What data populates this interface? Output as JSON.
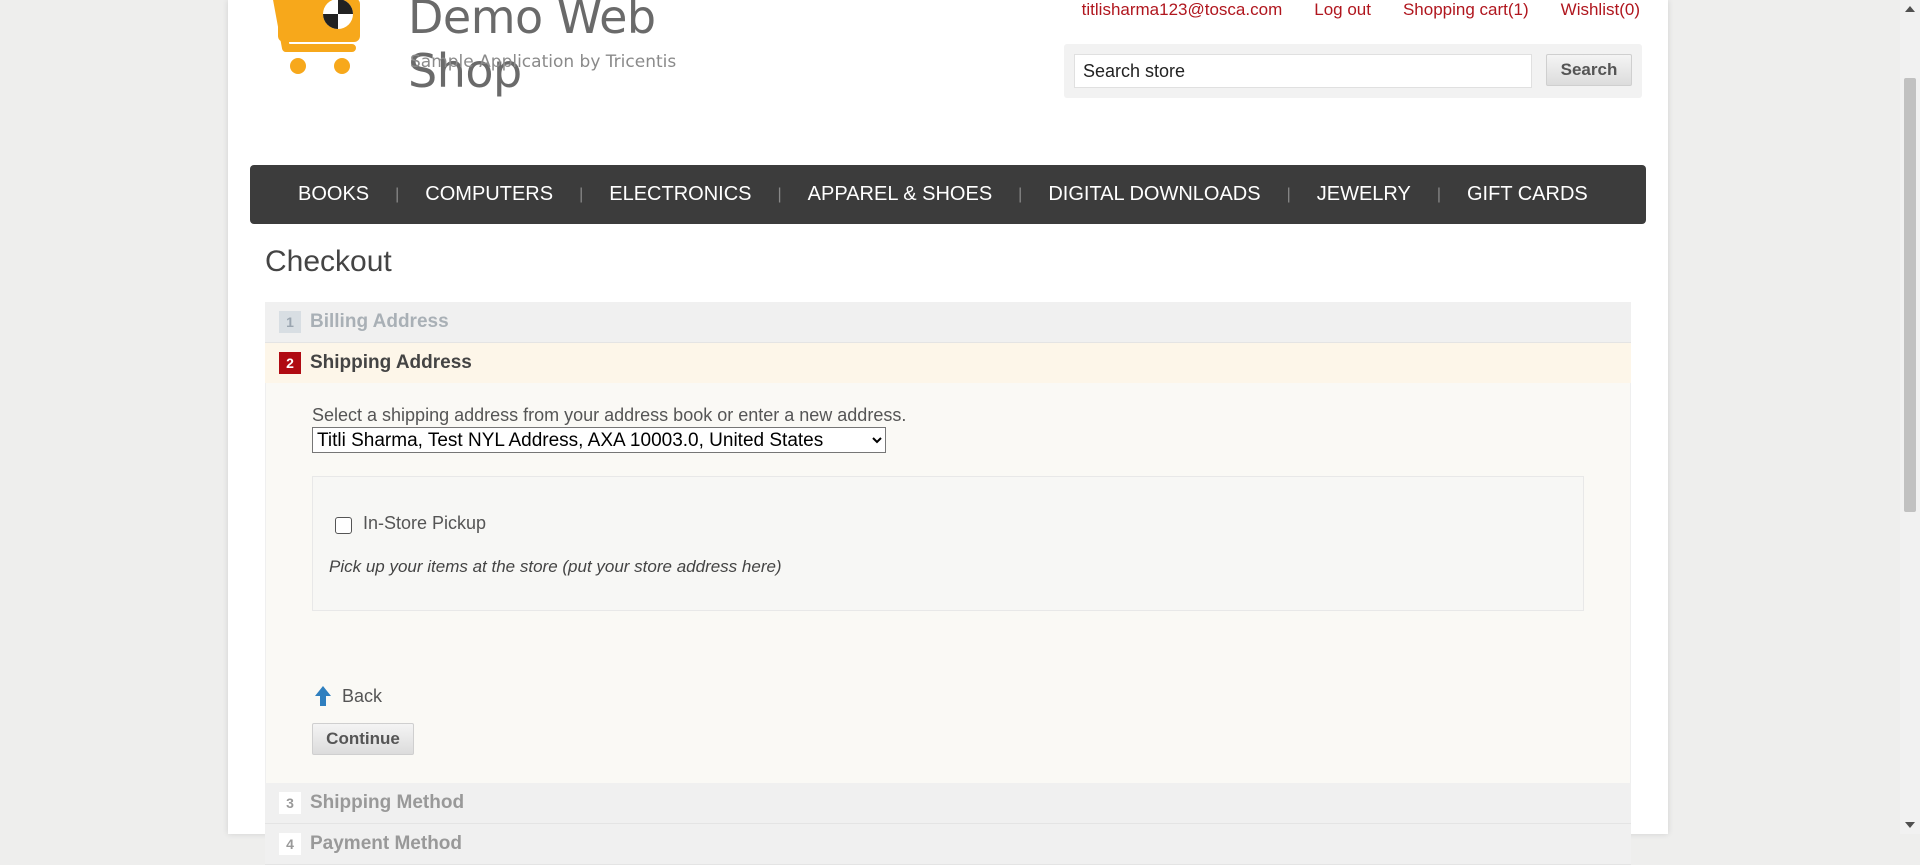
{
  "header": {
    "logo_title": "Demo Web Shop",
    "logo_subtitle": "Sample Application by Tricentis",
    "links": {
      "account": "titlisharma123@tosca.com",
      "logout": "Log out",
      "cart": "Shopping cart(1)",
      "wishlist": "Wishlist(0)"
    },
    "search": {
      "value": "Search store",
      "button": "Search"
    }
  },
  "nav": [
    "BOOKS",
    "COMPUTERS",
    "ELECTRONICS",
    "APPAREL & SHOES",
    "DIGITAL DOWNLOADS",
    "JEWELRY",
    "GIFT CARDS"
  ],
  "checkout": {
    "title": "Checkout",
    "steps": [
      {
        "num": "1",
        "title": "Billing Address",
        "state": "done"
      },
      {
        "num": "2",
        "title": "Shipping Address",
        "state": "active"
      },
      {
        "num": "3",
        "title": "Shipping Method",
        "state": "pending"
      },
      {
        "num": "4",
        "title": "Payment Method",
        "state": "pending"
      }
    ],
    "shipping": {
      "instruction": "Select a shipping address from your address book or enter a new address.",
      "selected_address": "Titli Sharma, Test NYL Address, AXA 10003.0, United States",
      "pickup_label": "In-Store Pickup",
      "pickup_checked": false,
      "pickup_description": "Pick up your items at the store (put your store address here)",
      "back_label": "Back",
      "continue_label": "Continue"
    }
  },
  "colors": {
    "accent": "#b00b12",
    "link": "#b0161e",
    "nav_bg": "#3c3c3c",
    "logo_orange": "#f7a81b"
  }
}
